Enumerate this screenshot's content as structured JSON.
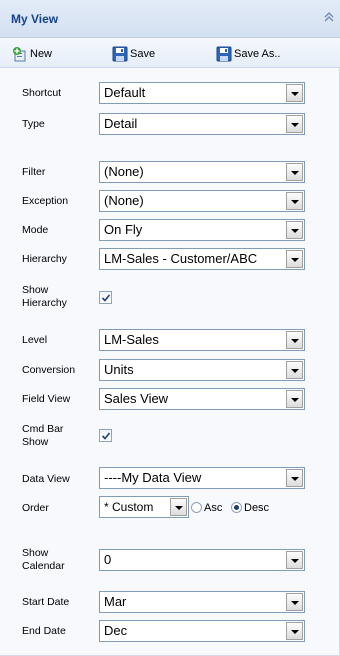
{
  "panel": {
    "title": "My View"
  },
  "toolbar": {
    "new_label": "New",
    "save_label": "Save",
    "save_as_label": "Save As.."
  },
  "form": {
    "shortcut": {
      "label": "Shortcut",
      "value": "Default"
    },
    "type": {
      "label": "Type",
      "value": "Detail"
    },
    "filter": {
      "label": "Filter",
      "value": "(None)"
    },
    "exception": {
      "label": "Exception",
      "value": "(None)"
    },
    "mode": {
      "label": "Mode",
      "value": "On Fly"
    },
    "hierarchy": {
      "label": "Hierarchy",
      "value": "LM-Sales - Customer/ABC"
    },
    "show_hierarchy": {
      "label_line1": "Show",
      "label_line2": "Hierarchy",
      "checked": true
    },
    "level": {
      "label": "Level",
      "value": "LM-Sales"
    },
    "conversion": {
      "label": "Conversion",
      "value": "Units"
    },
    "field_view": {
      "label": "Field View",
      "value": "Sales View"
    },
    "cmd_bar_show": {
      "label_line1": "Cmd Bar",
      "label_line2": "Show",
      "checked": true
    },
    "data_view": {
      "label": "Data View",
      "value": "----My Data View"
    },
    "order": {
      "label": "Order",
      "value": "* Custom",
      "asc_label": "Asc",
      "desc_label": "Desc",
      "selected": "Desc"
    },
    "show_calendar": {
      "label_line1": "Show",
      "label_line2": "Calendar",
      "value": "0"
    },
    "start_date": {
      "label": "Start Date",
      "value": "Mar"
    },
    "end_date": {
      "label": "End Date",
      "value": "Dec"
    }
  },
  "icons": {
    "new": "new-document-icon",
    "save": "floppy-disk-icon",
    "save_as": "floppy-disk-icon",
    "collapse": "double-chevron-up-icon"
  },
  "colors": {
    "title_text": "#15428b",
    "header_bg": "#d3e0f1",
    "select_border": "#7f9db9"
  }
}
